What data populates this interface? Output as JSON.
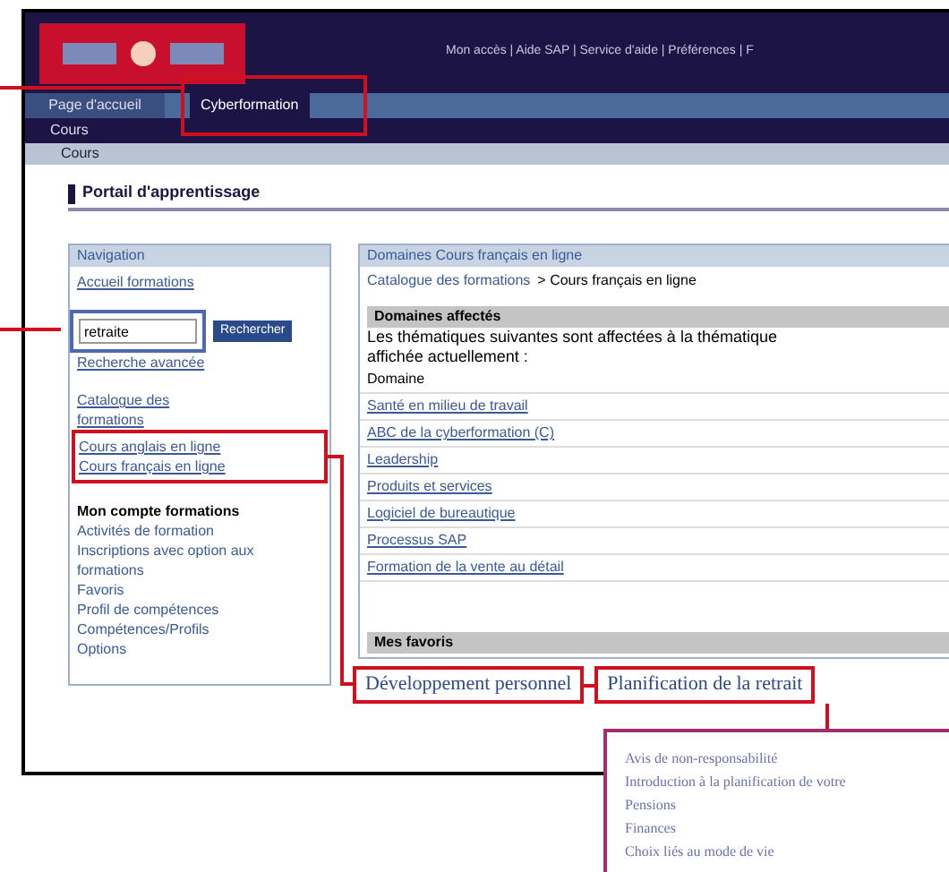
{
  "header": {
    "top_links": "Mon accès | Aide SAP | Service d'aide | Préférences | F"
  },
  "tabs": [
    {
      "label": "Page d'accueil",
      "selected": false
    },
    {
      "label": "Cyberformation",
      "selected": true
    }
  ],
  "subnav": "Cours",
  "breadcrumb_bar": "Cours",
  "page_title": "Portail d'apprentissage",
  "navigation": {
    "title": "Navigation",
    "home_link": "Accueil formations",
    "search": {
      "value": "retraite",
      "button": "Rechercher"
    },
    "advanced_link": "Recherche avancée",
    "catalog_link": "Catalogue des formations",
    "course_links": [
      "Cours anglais en ligne",
      "Cours français en ligne"
    ],
    "account_title": "Mon compte formations",
    "account_links": [
      "Activités de formation",
      "Inscriptions avec option aux formations",
      "Favoris",
      "Profil de compétences",
      "Compétences/Profils",
      "Options"
    ]
  },
  "content": {
    "title": "Domaines Cours français en ligne",
    "breadcrumb_link": "Catalogue des formations",
    "breadcrumb_current": "> Cours français en ligne",
    "section_title": "Domaines affectés",
    "description": "Les thématiques suivantes sont affectées à la thématique affichée actuellement :",
    "column": "Domaine",
    "domains": [
      "Santé en milieu de travail",
      "ABC de la cyberformation (C)",
      "Leadership",
      "Produits et services",
      "Logiciel de bureautique",
      "Processus SAP",
      "Formation de la vente au détail"
    ],
    "favorites_title": "Mes favoris"
  },
  "callouts": {
    "labels": [
      "Développement personnel",
      "Planification de la retrait"
    ],
    "popup_items": [
      "Avis de non-responsabilité",
      "Introduction à la planification de votre",
      "Pensions",
      "Finances",
      "Choix liés au mode de vie"
    ]
  }
}
